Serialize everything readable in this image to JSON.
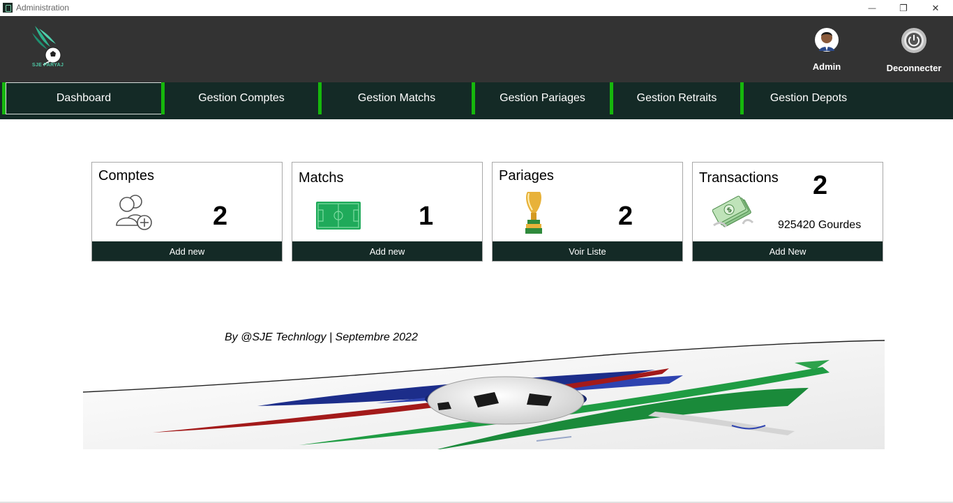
{
  "window": {
    "title": "Administration",
    "controls": {
      "minimize": "—",
      "restore": "❐",
      "close": "✕"
    }
  },
  "header": {
    "logo_text": "SJE PARYAJ",
    "admin_label": "Admin",
    "logout_label": "Deconnecter"
  },
  "nav": {
    "items": [
      {
        "label": "Dashboard",
        "active": true
      },
      {
        "label": "Gestion Comptes"
      },
      {
        "label": "Gestion Matchs"
      },
      {
        "label": "Gestion Pariages"
      },
      {
        "label": "Gestion Retraits"
      },
      {
        "label": "Gestion Depots"
      }
    ]
  },
  "cards": [
    {
      "title": "Comptes",
      "count": "2",
      "footer": "Add new",
      "icon": "add-user-icon"
    },
    {
      "title": "Matchs",
      "count": "1",
      "footer": "Add new",
      "icon": "soccer-field-icon"
    },
    {
      "title": "Pariages",
      "count": "2",
      "footer": "Voir Liste",
      "icon": "trophy-icon"
    },
    {
      "title": "Transactions",
      "count": "2",
      "amount": "925420 Gourdes",
      "footer": "Add New",
      "icon": "money-icon"
    }
  ],
  "footer": {
    "credit": "By @SJE Technlogy | Septembre 2022"
  },
  "colors": {
    "header_bg": "#333333",
    "nav_bg": "#142a26",
    "nav_separator": "#16b70c",
    "card_footer_bg": "#142a26",
    "logo_accent": "#4fc7a5"
  }
}
